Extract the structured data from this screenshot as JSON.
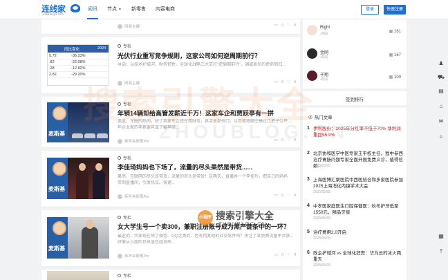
{
  "header": {
    "logo_text": "连线家",
    "logo_sub": "lianxianjia.com",
    "nav": [
      {
        "label": "闻讯",
        "active": true
      },
      {
        "label": "节点",
        "caret": true
      },
      {
        "label": "新零售"
      },
      {
        "label": "内容电商"
      }
    ],
    "login_label": "登录",
    "register_label": "快速注册"
  },
  "articles": [
    {
      "author": "网易主编",
      "comments": "0",
      "likes": "0"
    },
    {
      "topic": "专栏",
      "title": "光伏行业重写竞争规则，这家公司如何逆周期前行？",
      "excerpt": "导语：以技术护城河、财务韧性、全球化战略三大支柱\"逆周期前行\"，通威股份的使命回归...",
      "author": "网易主编",
      "comments": "0",
      "likes": "0",
      "table": {
        "head": [
          "同比变化",
          "2024"
        ],
        "rows": [
          [
            "5.72",
            "-36.23%"
          ],
          [
            ".82",
            "-22.08%"
          ],
          [
            ".28",
            "-12.82%"
          ],
          [
            "2.82",
            "-29.20%"
          ]
        ]
      }
    },
    {
      "topic": "专栏",
      "title": "年销14辆却给高管发薪近千万！这家车企和贾跃亭有一拼",
      "excerpt": "美股、车圈的热闹，除了英家车企还在用财务，其余全部去口，以及极物跳空搞过几把子公开...",
      "excerpt2": "年企业家的年薪要月或了最早暗...",
      "author": "疾听夹新舰Pro",
      "comments": "0",
      "likes": "0",
      "thumb_brand": "麦斯基"
    },
    {
      "topic": "专栏",
      "title": "李佳琦妈妈也下场了，流量的尽头果然是带货......",
      "excerpt": "果然，互联网的尽头是带货，流量的尽头是带货！这两天，直播界一个李佳玲，把自己的妈妈",
      "excerpt2": "带到直播间，引发热议。快速...",
      "author": "疾听夹新舰Pro",
      "comments": "0",
      "likes": "0",
      "thumb_brand": "麦斯基"
    },
    {
      "topic": "专栏",
      "title": "女大学生号一个卖300，兼职注册账号成为黑产链条中的一环？",
      "excerpt": "最近的，大家现在除了微信、QQ之类的，还有用其他的社交软件吗？关注了某免费流量平台获...",
      "excerpt2": "好像从小朋的世界里已经消失...",
      "author": "疾听夹新舰Pro",
      "comments": "0",
      "likes": "0",
      "thumb_brand": "麦斯基"
    },
    {
      "topic": "专栏"
    }
  ],
  "sidebar": {
    "ranking": [
      {
        "name": "Right",
        "sub": "2周前",
        "count": "161"
      },
      {
        "name": "金网",
        "sub": "4月前",
        "count": "167"
      },
      {
        "name": "于翔",
        "sub": "4月前",
        "count": "100"
      }
    ],
    "rank_heading": "签到排行",
    "hot_heading": "热门文章",
    "hot": [
      {
        "num": "1",
        "text": "伊利股份：2025年分红率不低于70% 净利润重回55.9%",
        "date": "2025/05/05",
        "red": true
      },
      {
        "num": "2",
        "text": "北京协和医学中医专家王平权主任，我中参西治疗胃肠问题专家全面开展免费义诊，值得信赖...",
        "date": "2025/05/05"
      },
      {
        "num": "3",
        "text": "上海医博汇聚医院中西医结合和多家医院参加2025上海消化内镜学术大会",
        "date": "2025/05/05"
      },
      {
        "num": "4",
        "text": "中孝医家庭医生口腔保健医：秋冬护牙低至1550元，精品牙星",
        "date": "2025/05/05"
      },
      {
        "num": "5",
        "text": "治疗费用2.0开启",
        "date": "2025/05/05"
      },
      {
        "num": "6",
        "text": "政企护城河 vs 全球化狂奔：华为云的冰火两重天",
        "date": "2025/05/05"
      }
    ]
  },
  "float_bar": [
    {
      "icon": "user-icon",
      "glyph": "♟"
    },
    {
      "icon": "cart-icon",
      "glyph": "⛟"
    },
    {
      "icon": "doc-icon",
      "glyph": "▤"
    },
    {
      "icon": "gift-icon",
      "glyph": "⌂"
    },
    {
      "icon": "mail-icon",
      "glyph": "✉"
    },
    {
      "icon": "search-icon",
      "glyph": "⌕"
    },
    {
      "icon": "qr-icon",
      "glyph": "▦"
    },
    {
      "icon": "top-icon",
      "glyph": "⤒"
    }
  ],
  "watermark": {
    "big": "搜索引擎大全",
    "big_en": "ZHOUBLOG.CN",
    "small_badge": "小程序",
    "small": "搜索引擎大全",
    "small_en": "ZHOUBLOG.CN"
  }
}
